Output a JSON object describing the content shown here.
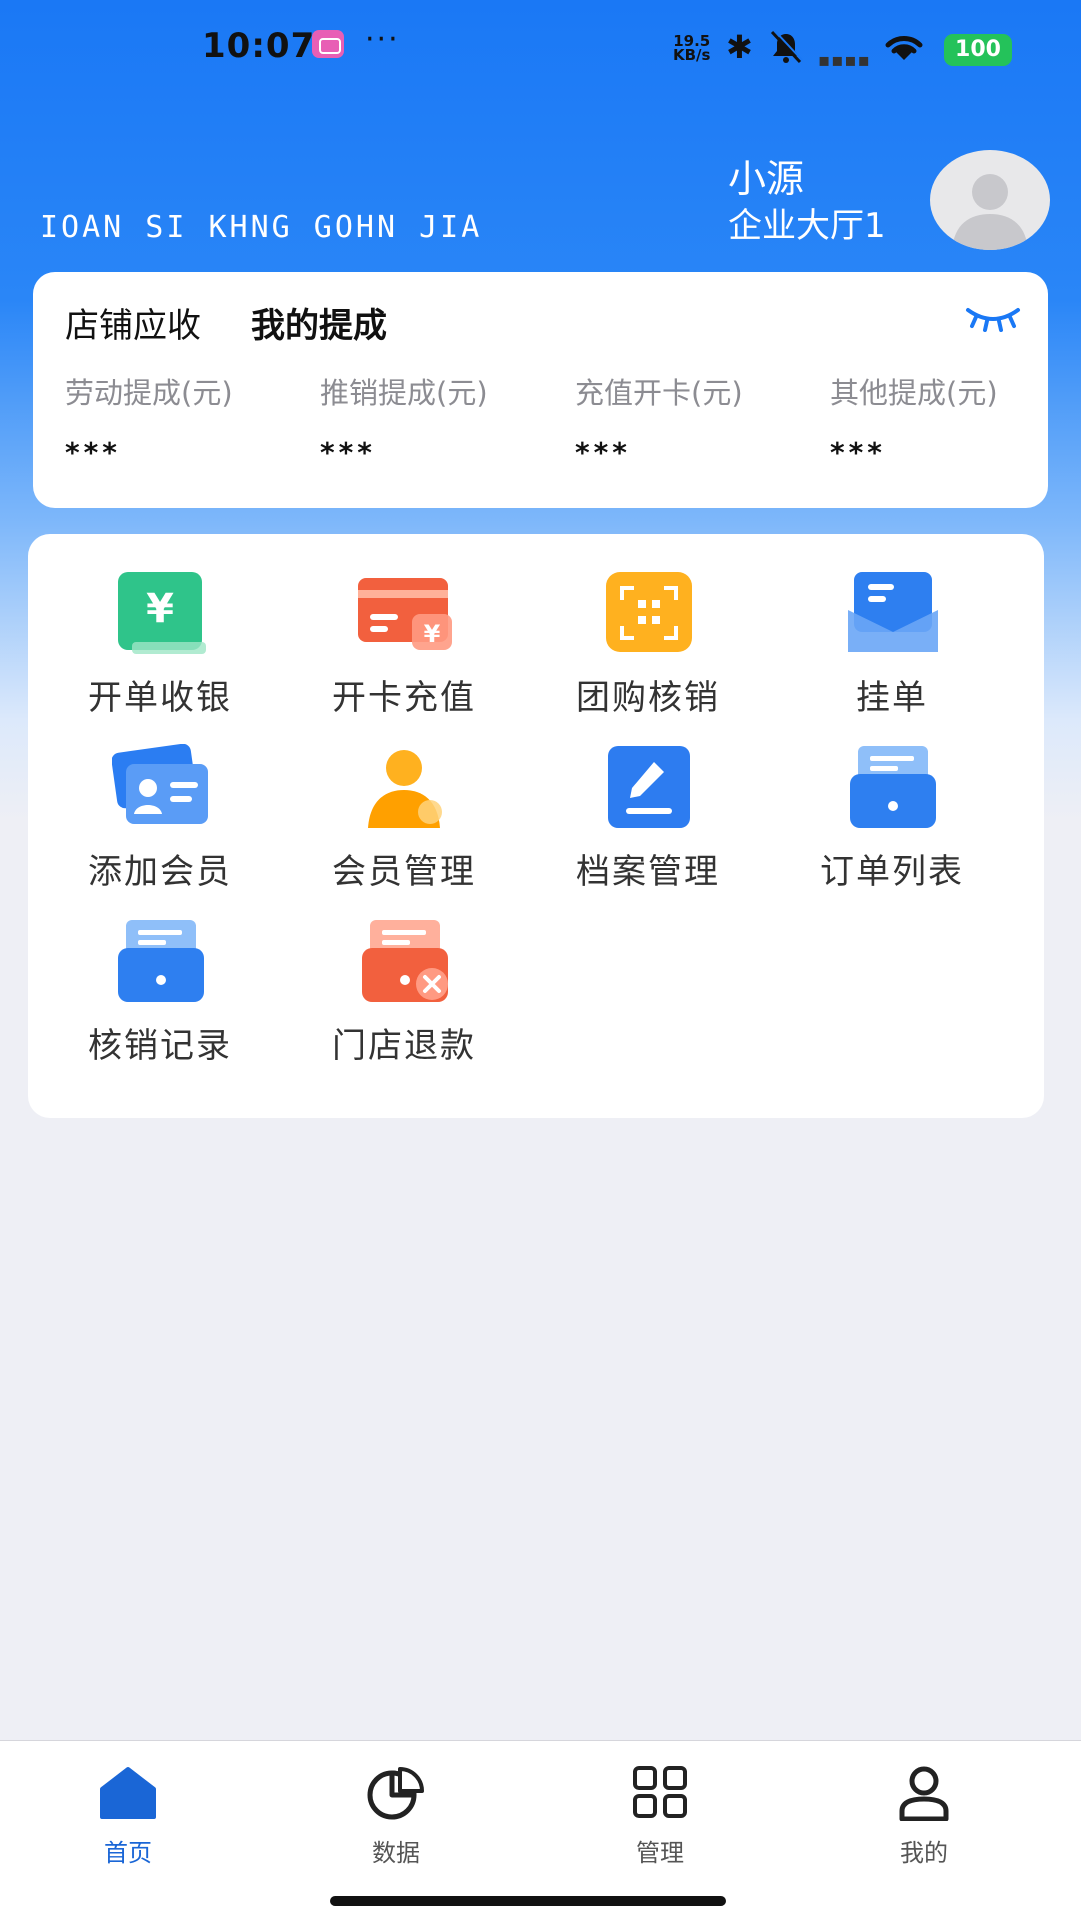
{
  "status_bar": {
    "time": "10:07",
    "more": "···",
    "net_speed_value": "19.5",
    "net_speed_unit": "KB/s",
    "battery": "100",
    "icons": [
      "app-badge-icon",
      "bluetooth-icon",
      "mute-icon",
      "signal-icon",
      "wifi-icon",
      "battery-icon"
    ]
  },
  "header": {
    "company": "IOAN SI KHNG GOHN JIA",
    "user_name": "小源",
    "store": "企业大厅1"
  },
  "commission": {
    "tabs": [
      {
        "label": "店铺应收",
        "active": false
      },
      {
        "label": "我的提成",
        "active": true
      }
    ],
    "metrics": [
      {
        "label": "劳动提成(元)",
        "value": "***"
      },
      {
        "label": "推销提成(元)",
        "value": "***"
      },
      {
        "label": "充值开卡(元)",
        "value": "***"
      },
      {
        "label": "其他提成(元)",
        "value": "***"
      }
    ]
  },
  "functions": [
    {
      "label": "开单收银",
      "icon": "yuan-bill-icon"
    },
    {
      "label": "开卡充值",
      "icon": "card-recharge-icon"
    },
    {
      "label": "团购核销",
      "icon": "qr-scan-icon"
    },
    {
      "label": "挂单",
      "icon": "envelope-icon"
    },
    {
      "label": "添加会员",
      "icon": "member-card-icon"
    },
    {
      "label": "会员管理",
      "icon": "person-icon"
    },
    {
      "label": "档案管理",
      "icon": "edit-icon"
    },
    {
      "label": "订单列表",
      "icon": "order-tray-icon"
    },
    {
      "label": "核销记录",
      "icon": "record-tray-icon"
    },
    {
      "label": "门店退款",
      "icon": "refund-icon"
    }
  ],
  "bottom_nav": [
    {
      "label": "首页",
      "icon": "home-icon",
      "active": true
    },
    {
      "label": "数据",
      "icon": "pie-chart-icon",
      "active": false
    },
    {
      "label": "管理",
      "icon": "grid-icon",
      "active": false
    },
    {
      "label": "我的",
      "icon": "user-icon",
      "active": false
    }
  ],
  "colors": {
    "primary": "#1a78f5",
    "active_nav": "#1a66d6",
    "battery": "#24c25a"
  }
}
